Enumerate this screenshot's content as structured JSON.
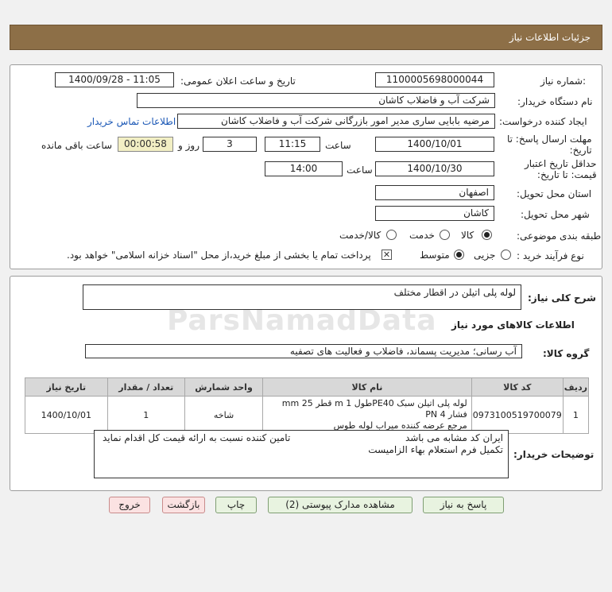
{
  "header": {
    "title": "جزئیات اطلاعات نیاز"
  },
  "form": {
    "need_number_label": "شماره نیاز:",
    "need_number": "1100005698000044",
    "announce_label": "تاریخ و ساعت اعلان عمومی:",
    "announce_value": "1400/09/28 - 11:05",
    "buyer_label": "نام دستگاه خریدار:",
    "buyer_value": "شرکت آب و فاضلاب کاشان",
    "creator_label": "ایجاد کننده درخواست:",
    "creator_value": "مرضیه بابایی ساری مدیر امور بازرگانی شرکت آب و فاضلاب کاشان",
    "contact_link": "اطلاعات تماس خریدار",
    "deadline_label_1": "مهلت ارسال پاسخ: تا",
    "deadline_label_2": "تاریخ:",
    "deadline_date": "1400/10/01",
    "time_label": "ساعت",
    "deadline_time": "11:15",
    "days_value": "3",
    "days_label": "روز و",
    "remaining_time": "00:00:58",
    "remaining_label": "ساعت باقی مانده",
    "validity_label_1": "حداقل تاریخ اعتبار",
    "validity_label_2": "قیمت: تا تاریخ:",
    "validity_date": "1400/10/30",
    "validity_time_label": "ساعت",
    "validity_time": "14:00",
    "province_label": "استان محل تحویل:",
    "province_value": "اصفهان",
    "city_label": "شهر محل تحویل:",
    "city_value": "کاشان",
    "category_label": "طبقه بندی موضوعی:",
    "category_options": [
      "کالا",
      "خدمت",
      "کالا/خدمت"
    ],
    "category_selected": "کالا",
    "process_label": "نوع فرآیند خرید :",
    "process_options": [
      "جزیی",
      "متوسط"
    ],
    "process_selected": "متوسط",
    "payment_note": "پرداخت تمام یا بخشی از مبلغ خرید،از محل \"اسناد خزانه اسلامی\" خواهد بود."
  },
  "general": {
    "desc_label": "شرح کلی نیاز:",
    "desc_value": "لوله پلی اتیلن در اقطار مختلف"
  },
  "goods": {
    "section_title": "اطلاعات کالاهای مورد نیاز",
    "group_label": "گروه کالا:",
    "group_value": "آب رسانی؛ مدیریت پسماند، فاضلاب و فعالیت های تصفیه",
    "columns": [
      "ردیف",
      "کد کالا",
      "نام کالا",
      "واحد شمارش",
      "تعداد / مقدار",
      "تاریخ نیاز"
    ],
    "rows": [
      {
        "row": "1",
        "code": "0973100519700079",
        "name_line1": "لوله پلی اتیلن سبک PE40طول 1 m قطر 25 mm فشار 4 PN",
        "name_line2": "مرجع عرضه کننده میراب لوله طوس",
        "unit": "شاخه",
        "qty": "1",
        "date": "1400/10/01"
      }
    ]
  },
  "buyer_notes": {
    "label": "توضیحات خریدار:",
    "line1_a": "ایران کد مشابه می باشد",
    "line1_b": "تامین کننده نسبت به ارائه قیمت کل اقدام نماید",
    "line2": "تکمیل فرم استعلام بهاء الزامیست"
  },
  "buttons": {
    "reply": "پاسخ به نیاز",
    "attachments": "مشاهده مدارک پیوستی (2)",
    "print": "چاپ",
    "back": "بازگشت",
    "exit": "خروج"
  },
  "watermark": {
    "text": "ParsNamadData"
  }
}
